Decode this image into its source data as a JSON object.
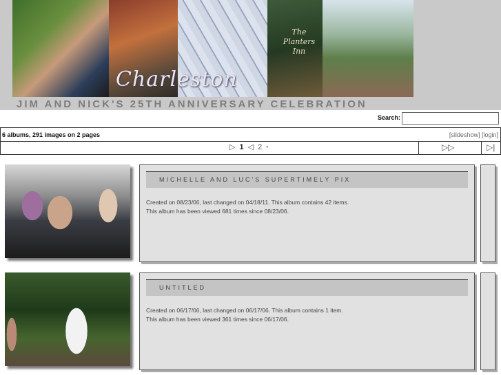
{
  "header": {
    "banner_script": "Charleston",
    "banner_sign": "The Planters Inn",
    "title": "JIM AND NICK'S 25TH ANNIVERSARY CELEBRATION"
  },
  "search": {
    "label": "Search:",
    "value": ""
  },
  "info": {
    "count_text": "6 albums, 291 images on 2 pages",
    "slideshow_link": "[slideshow]",
    "login_link": "[login]"
  },
  "pager": {
    "prev_icon": "▷",
    "current_page": "1",
    "prev_page_icon": "◁",
    "page2": "2",
    "dot": "•",
    "fast_forward_icon": "▷▷",
    "last_icon": "▷|"
  },
  "albums": [
    {
      "title": "MICHELLE AND LUC'S SUPERTIMELY PIX",
      "line1": "Created on 08/23/06, last changed on 04/18/11. This album contains 42 items.",
      "line2": "This album has been viewed 681 times since 08/23/06."
    },
    {
      "title": "UNTITLED",
      "line1": "Created on 06/17/06, last changed on 06/17/06. This album contains 1 item.",
      "line2": "This album has been viewed 361 times since 06/17/06."
    }
  ]
}
